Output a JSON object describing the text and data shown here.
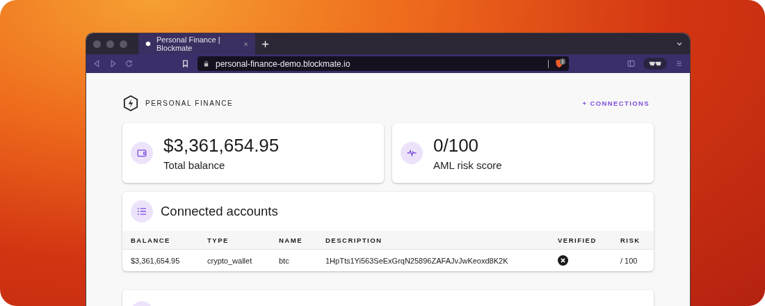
{
  "browser": {
    "tab_title": "Personal Finance | Blockmate",
    "url": "personal-finance-demo.blockmate.io",
    "shield_badge": "1"
  },
  "header": {
    "brand": "PERSONAL FINANCE",
    "link": "+ CONNECTIONS"
  },
  "stats": [
    {
      "kind": "wallet",
      "value": "$3,361,654.95",
      "label": "Total balance"
    },
    {
      "kind": "pulse",
      "value": "0/100",
      "label": "AML risk score"
    }
  ],
  "accounts": {
    "title": "Connected accounts",
    "columns": [
      "BALANCE",
      "TYPE",
      "NAME",
      "DESCRIPTION",
      "VERIFIED",
      "RISK"
    ],
    "rows": [
      {
        "balance": "$3,361,654.95",
        "type": "crypto_wallet",
        "name": "btc",
        "description": "1HpTts1Yi563SeExGrqN25896ZAFAJvJwKeoxd8K2K",
        "verified": false,
        "risk": "/ 100"
      }
    ]
  }
}
